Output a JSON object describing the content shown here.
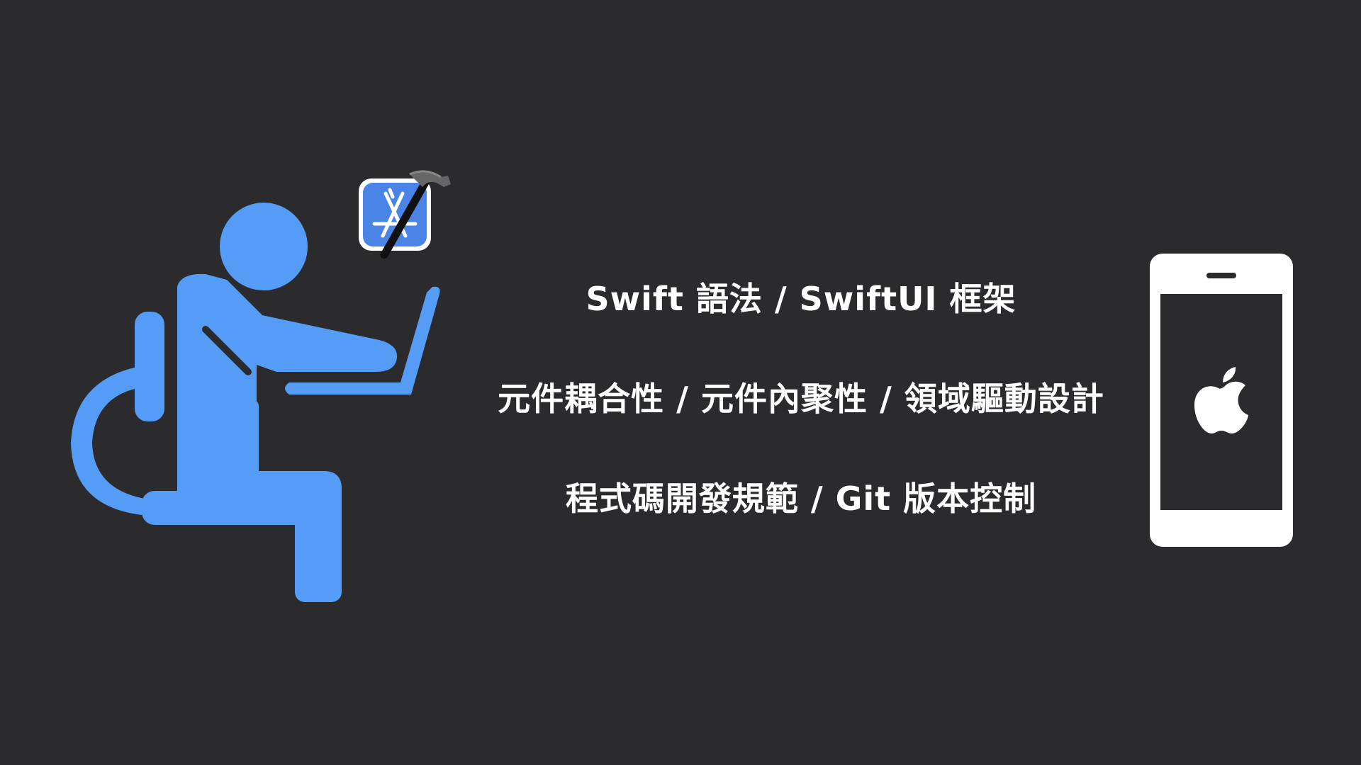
{
  "topics": [
    "Swift 語法 / SwiftUI 框架",
    "元件耦合性 / 元件內聚性 / 領域驅動設計",
    "程式碼開發規範 / Git 版本控制"
  ],
  "icons": {
    "person": "developer-at-laptop-icon",
    "xcode": "xcode-hammer-icon",
    "phone": "iphone-icon",
    "apple": "apple-logo-icon"
  },
  "colors": {
    "background": "#2b2a2c",
    "figure": "#559cf7",
    "text": "#ffffff",
    "phone_screen": "#2b2a2c"
  }
}
